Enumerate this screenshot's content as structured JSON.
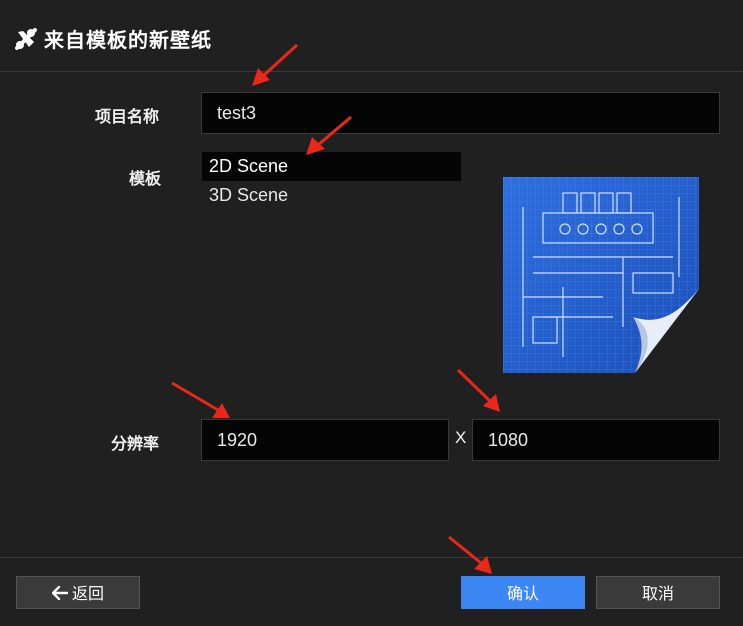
{
  "title": "来自模板的新壁纸",
  "project_name": {
    "label": "项目名称",
    "value": "test3"
  },
  "template": {
    "label": "模板",
    "options": [
      "2D Scene",
      "3D Scene"
    ],
    "selected_index": 0
  },
  "resolution": {
    "label": "分辨率",
    "width": "1920",
    "separator": "X",
    "height": "1080"
  },
  "buttons": {
    "back": "返回",
    "confirm": "确认",
    "cancel": "取消"
  },
  "colors": {
    "background": "#202020",
    "field": "#050505",
    "primary": "#3d87f5",
    "annotation_arrow": "#e8281a"
  },
  "icons": {
    "title": "wallpaper-tools-icon",
    "back": "arrow-left-icon",
    "preview": "blueprint-document-icon"
  }
}
